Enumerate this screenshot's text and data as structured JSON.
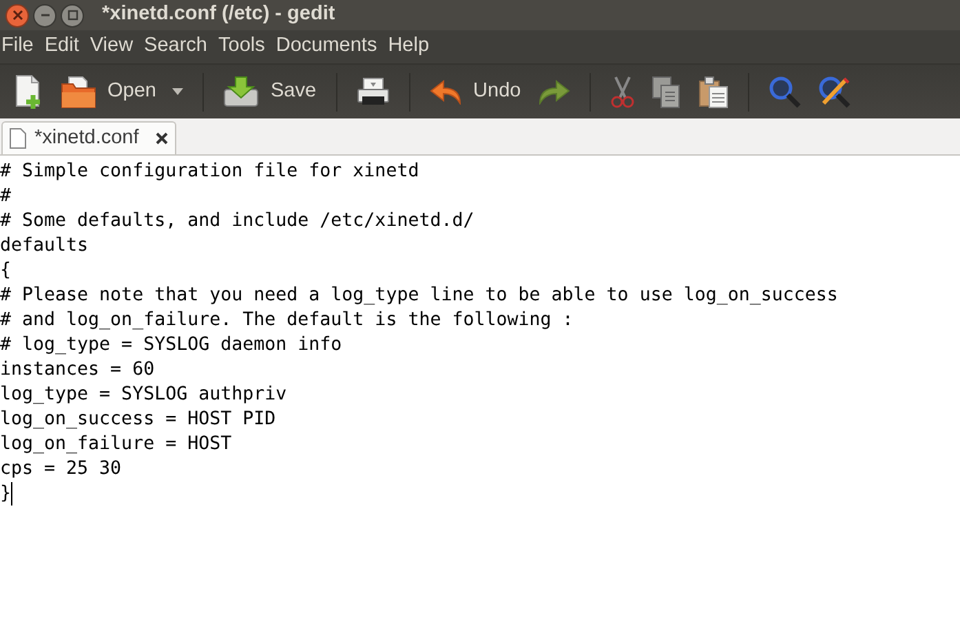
{
  "window": {
    "title": "*xinetd.conf (/etc) - gedit"
  },
  "menu": [
    "File",
    "Edit",
    "View",
    "Search",
    "Tools",
    "Documents",
    "Help"
  ],
  "toolbar": [
    {
      "kind": "new"
    },
    {
      "kind": "open",
      "label": "Open"
    },
    {
      "kind": "dropdown"
    },
    {
      "kind": "sep"
    },
    {
      "kind": "save",
      "label": "Save"
    },
    {
      "kind": "sep"
    },
    {
      "kind": "print"
    },
    {
      "kind": "sep"
    },
    {
      "kind": "undo",
      "label": "Undo"
    },
    {
      "kind": "redo"
    },
    {
      "kind": "sep"
    },
    {
      "kind": "cut"
    },
    {
      "kind": "copy"
    },
    {
      "kind": "paste"
    },
    {
      "kind": "sep"
    },
    {
      "kind": "find"
    },
    {
      "kind": "replace"
    }
  ],
  "tabs": [
    {
      "label": "*xinetd.conf",
      "selected": true
    }
  ],
  "editor": {
    "lines": [
      "# Simple configuration file for xinetd",
      "#",
      "# Some defaults, and include /etc/xinetd.d/",
      "defaults",
      "{",
      "# Please note that you need a log_type line to be able to use log_on_success",
      "# and log_on_failure. The default is the following :",
      "# log_type = SYSLOG daemon info",
      "instances = 60",
      "log_type = SYSLOG authpriv",
      "log_on_success = HOST PID",
      "log_on_failure = HOST",
      "cps = 25 30",
      "}"
    ]
  }
}
